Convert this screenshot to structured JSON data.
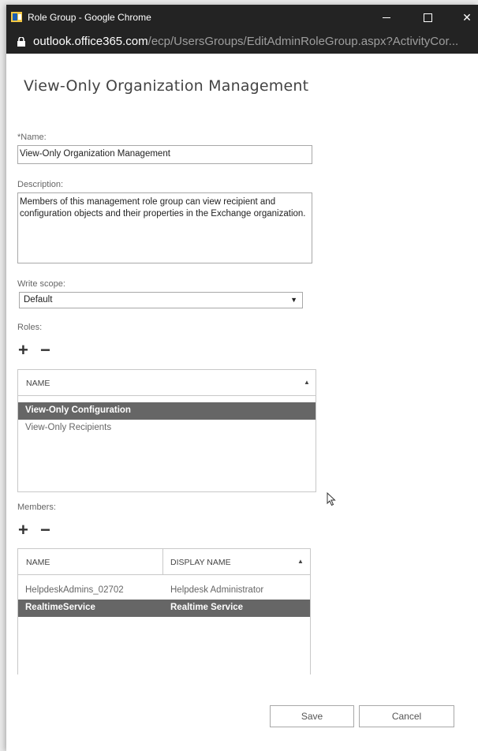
{
  "window": {
    "title": "Role Group - Google Chrome",
    "url_host": "outlook.office365.com",
    "url_path": "/ecp/UsersGroups/EditAdminRoleGroup.aspx?ActivityCor..."
  },
  "page": {
    "title": "View-Only Organization Management"
  },
  "form": {
    "name_label": "*Name:",
    "name_value": "View-Only Organization Management",
    "description_label": "Description:",
    "description_value": "Members of this management role group can view recipient and configuration objects and their properties in the Exchange organization.",
    "write_scope_label": "Write scope:",
    "write_scope_value": "Default",
    "roles_label": "Roles:",
    "members_label": "Members:"
  },
  "roles": {
    "column_header": "NAME",
    "rows": [
      {
        "name": "View-Only Configuration",
        "selected": true
      },
      {
        "name": "View-Only Recipients",
        "selected": false
      }
    ]
  },
  "members": {
    "columns": [
      "NAME",
      "DISPLAY NAME"
    ],
    "rows": [
      {
        "name": "HelpdeskAdmins_02702",
        "display_name": "Helpdesk Administrator",
        "selected": false
      },
      {
        "name": "RealtimeService",
        "display_name": "Realtime Service",
        "selected": true
      }
    ]
  },
  "buttons": {
    "save": "Save",
    "cancel": "Cancel"
  },
  "icons": {
    "add": "+",
    "remove": "−",
    "sort": "▲",
    "dropdown": "▼",
    "close": "✕"
  },
  "colors": {
    "titlebar": "#232323",
    "selected_row": "#666666"
  }
}
